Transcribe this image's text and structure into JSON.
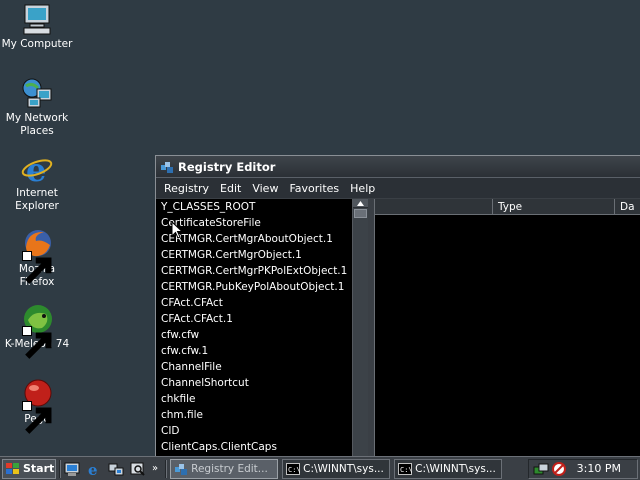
{
  "desktop": {
    "icons": [
      {
        "label_line1": "My Computer",
        "label_line2": ""
      },
      {
        "label_line1": "My Network",
        "label_line2": "Places"
      },
      {
        "label_line1": "Internet",
        "label_line2": "Explorer"
      },
      {
        "label_line1": "Mozilla Firefox",
        "label_line2": ""
      },
      {
        "label_line1": "K-Meleon 74",
        "label_line2": ""
      },
      {
        "label_line1": "Pego",
        "label_line2": ""
      }
    ]
  },
  "window": {
    "title": "Registry Editor",
    "menu": [
      "Registry",
      "Edit",
      "View",
      "Favorites",
      "Help"
    ],
    "tree_items": [
      "Y_CLASSES_ROOT",
      "CertificateStoreFile",
      "CERTMGR.CertMgrAboutObject.1",
      "CERTMGR.CertMgrObject.1",
      "CERTMGR.CertMgrPKPolExtObject.1",
      "CERTMGR.PubKeyPolAboutObject.1",
      "CFAct.CFAct",
      "CFAct.CFAct.1",
      "cfw.cfw",
      "cfw.cfw.1",
      "ChannelFile",
      "ChannelShortcut",
      "chkfile",
      "chm.file",
      "CID",
      "ClientCaps.ClientCaps"
    ],
    "list_columns": [
      "",
      "Type",
      "Da"
    ]
  },
  "taskbar": {
    "start_label": "Start",
    "chevron": "»",
    "tasks": [
      {
        "label": "Registry Edit...",
        "active": true
      },
      {
        "label": "C:\\WINNT\\sys...",
        "active": false
      },
      {
        "label": "C:\\WINNT\\sys...",
        "active": false
      }
    ],
    "clock": "3:10 PM"
  },
  "colors": {
    "desktop": "#2f3b44",
    "window_chrome": "#3a3f45",
    "pane_background": "#000000",
    "text": "#ffffff"
  }
}
